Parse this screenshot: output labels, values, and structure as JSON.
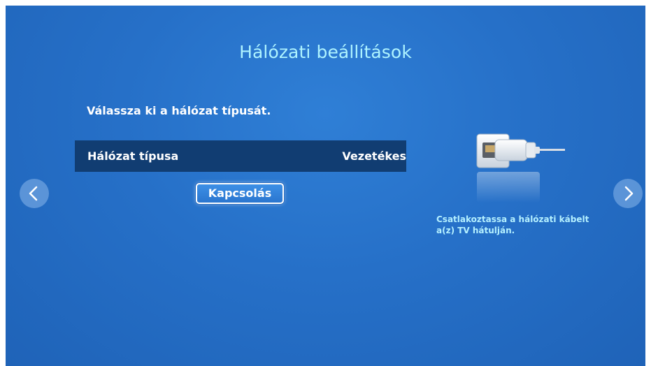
{
  "screen": {
    "title": "Hálózati beállítások",
    "prompt": "Válassza ki a hálózat típusát."
  },
  "network_type": {
    "label": "Hálózat típusa",
    "value": "Vezetékes"
  },
  "connect_button": {
    "label": "Kapcsolás"
  },
  "nav": {
    "prev_icon": "chevron-left-icon",
    "next_icon": "chevron-right-icon"
  },
  "help": {
    "illustration_icon": "ethernet-cable-icon",
    "text": "Csatlakoztassa a hálózati kábelt a(z) TV hátulján."
  },
  "colors": {
    "background": "#2670c8",
    "row_selected": "#113d72",
    "title_text": "#aef3ff",
    "hint_text": "#b4f0ff"
  }
}
